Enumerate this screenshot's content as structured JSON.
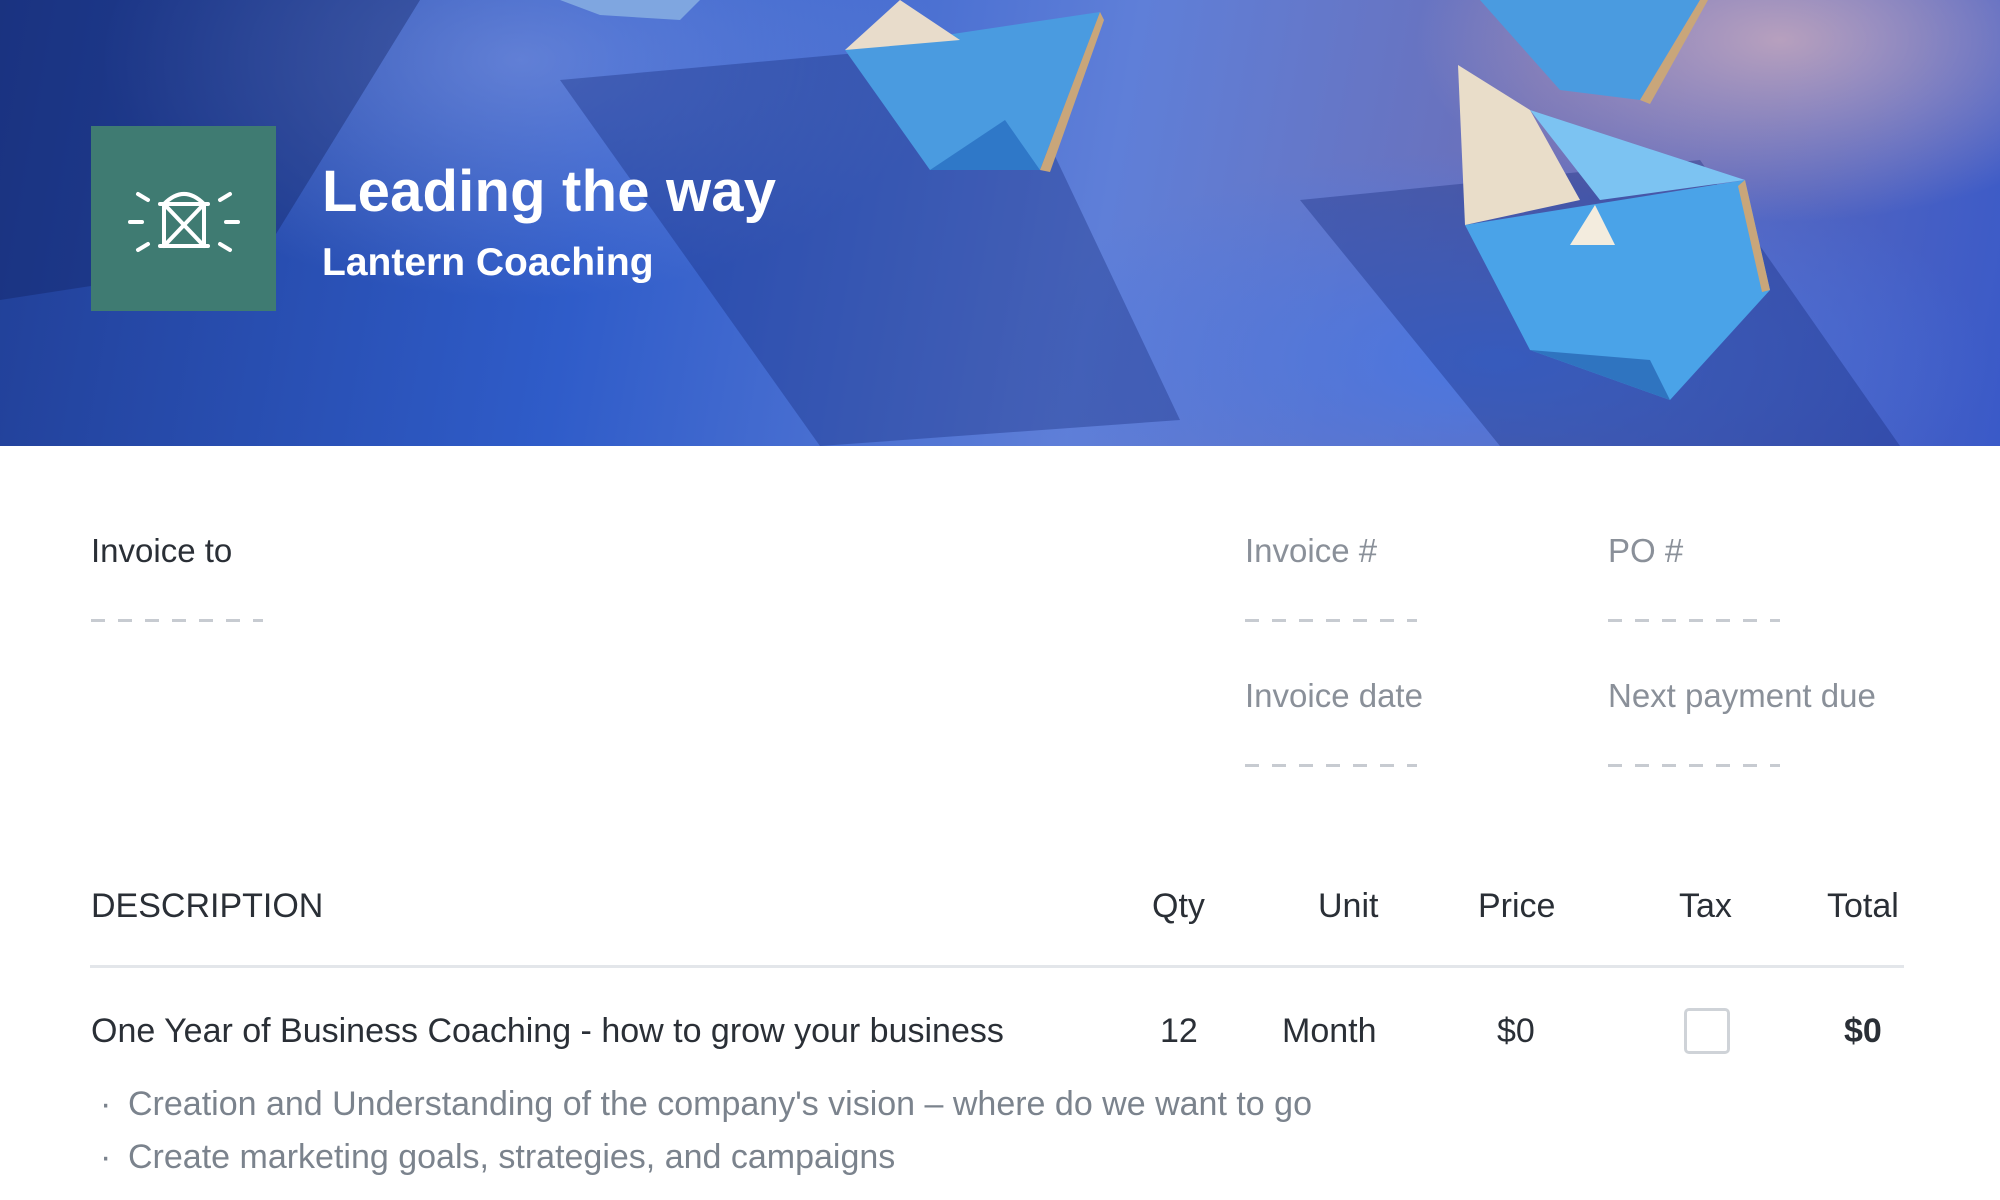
{
  "header": {
    "title": "Leading the way",
    "subtitle": "Lantern Coaching",
    "logo_icon": "lantern-icon",
    "logo_color": "#3f7b72"
  },
  "invoice_to": {
    "label": "Invoice to"
  },
  "meta": {
    "invoice_number_label": "Invoice #",
    "po_number_label": "PO #",
    "invoice_date_label": "Invoice date",
    "next_payment_label": "Next payment due"
  },
  "table": {
    "headers": {
      "description": "DESCRIPTION",
      "qty": "Qty",
      "unit": "Unit",
      "price": "Price",
      "tax": "Tax",
      "total": "Total"
    },
    "rows": [
      {
        "description": "One Year of Business Coaching - how to grow your business",
        "qty": "12",
        "unit": "Month",
        "price": "$0",
        "tax_checked": false,
        "total": "$0",
        "details": [
          "Creation and Understanding of the company's vision – where do we want to go",
          "Create marketing goals, strategies, and campaigns"
        ]
      }
    ]
  }
}
